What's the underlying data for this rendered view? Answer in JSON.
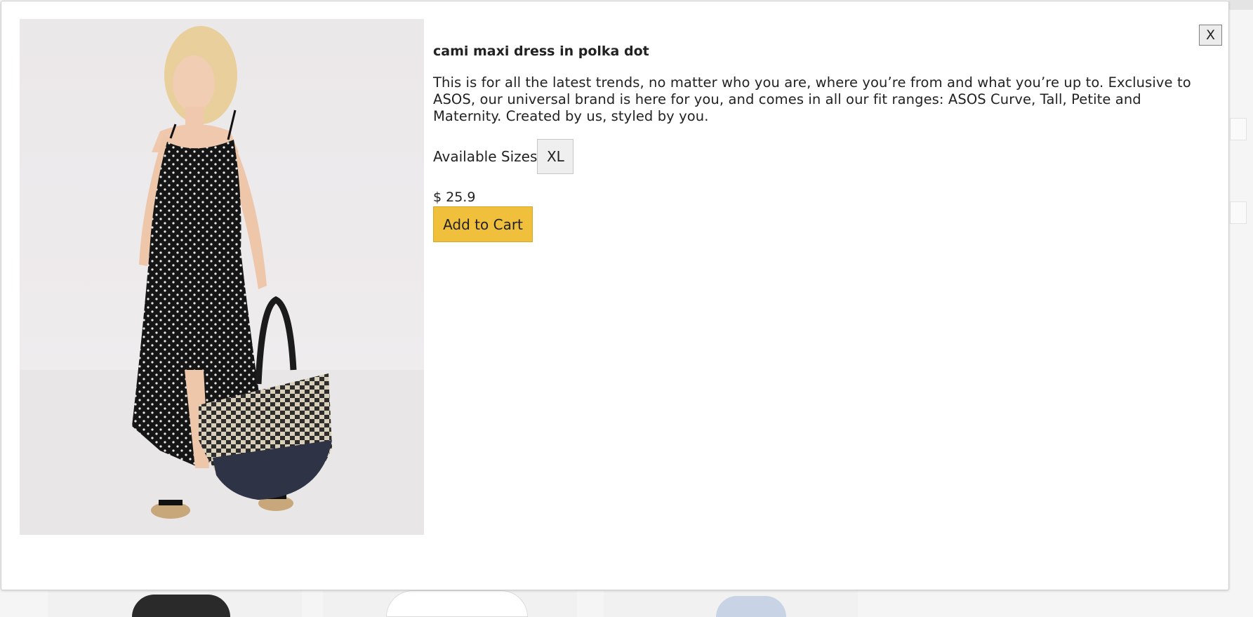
{
  "modal": {
    "close_label": "X",
    "product": {
      "image_alt": "Model wearing black polka dot cami maxi dress holding woven tote bag",
      "title": "cami maxi dress in polka dot",
      "description": "This is for all the latest trends, no matter who you are, where you’re from and what you’re up to. Exclusive to ASOS, our universal brand is here for you, and comes in all our fit ranges: ASOS Curve, Tall, Petite and Maternity. Created by us, styled by you.",
      "sizes_label": "Available Sizes",
      "sizes": [
        "XL"
      ],
      "price": "$ 25.9",
      "add_to_cart_label": "Add to Cart"
    }
  },
  "colors": {
    "cart_button": "#f0bf3c",
    "size_button": "#efefef",
    "close_button": "#ececec"
  }
}
